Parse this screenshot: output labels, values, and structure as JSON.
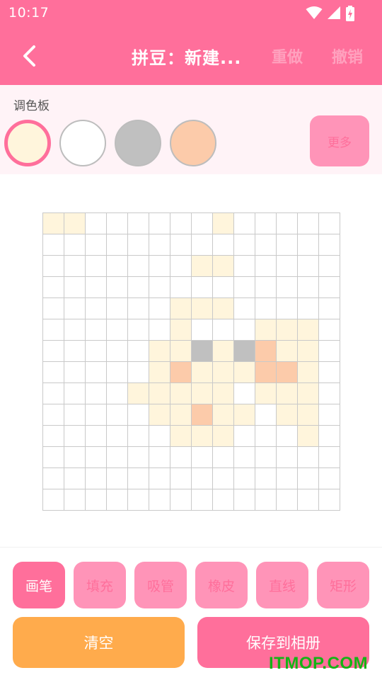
{
  "status_bar": {
    "time": "10:17"
  },
  "app_bar": {
    "title": "拼豆：新建...",
    "redo_label": "重做",
    "undo_label": "撤销"
  },
  "palette": {
    "title": "调色板",
    "more_label": "更多",
    "swatches": [
      {
        "color": "#fff5dc",
        "selected": true
      },
      {
        "color": "#ffffff",
        "selected": false
      },
      {
        "color": "#c0c0c0",
        "selected": false
      },
      {
        "color": "#fccbaa",
        "selected": false
      }
    ]
  },
  "canvas": {
    "columns": 14,
    "rows": 14,
    "colors": {
      "1": "#fff5dc",
      "2": "#c0c0c0",
      "3": "#fccbaa"
    },
    "pixels": [
      "11000000100000",
      "00000000000000",
      "00000001100000",
      "00000000000000",
      "00000011100000",
      "00000010001110",
      "00000112123110",
      "00000131113310",
      "00001111101110",
      "00000113110110",
      "00000011100010",
      "00000000000000",
      "00000000000000",
      "00000000000000"
    ]
  },
  "tools": [
    {
      "label": "画笔",
      "active": true
    },
    {
      "label": "填充",
      "active": false
    },
    {
      "label": "吸管",
      "active": false
    },
    {
      "label": "橡皮",
      "active": false
    },
    {
      "label": "直线",
      "active": false
    },
    {
      "label": "矩形",
      "active": false
    }
  ],
  "actions": {
    "clear_label": "清空",
    "save_label": "保存到相册"
  },
  "watermark": "ITMOP.COM"
}
